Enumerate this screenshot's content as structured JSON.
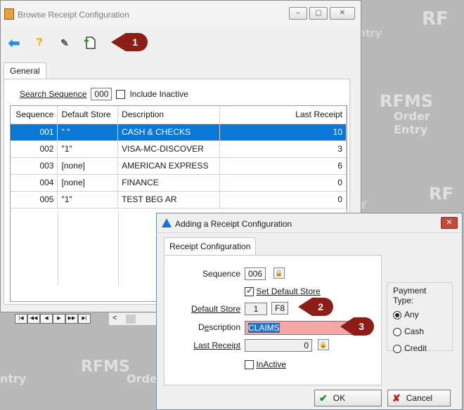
{
  "watermarks": [
    {
      "text": "RFMS",
      "sub": "Order Entry"
    }
  ],
  "browse": {
    "title": "Browse Receipt Configuration",
    "window_buttons": [
      "–",
      "▢",
      "✕"
    ],
    "toolbar_icons": [
      "back-arrow-icon",
      "help-question-icon",
      "tools-icon",
      "add-document-icon",
      "delete-document-icon"
    ],
    "tab": "General",
    "search_label": "Search Sequence",
    "search_value": "000",
    "include_inactive": "Include Inactive",
    "columns": [
      "Sequence",
      "Default Store",
      "Description",
      "Last Receipt"
    ],
    "rows": [
      {
        "seq": "001",
        "store": "\" \"",
        "desc": "CASH & CHECKS",
        "last": "10"
      },
      {
        "seq": "002",
        "store": "\"1\"",
        "desc": "VISA-MC-DISCOVER",
        "last": "3"
      },
      {
        "seq": "003",
        "store": "[none]",
        "desc": "AMERICAN EXPRESS",
        "last": "6"
      },
      {
        "seq": "004",
        "store": "[none]",
        "desc": "FINANCE",
        "last": "0"
      },
      {
        "seq": "005",
        "store": "\"1\"",
        "desc": "TEST BEG AR",
        "last": "0"
      }
    ],
    "nav_buttons": [
      "|◀",
      "◀◀",
      "◀",
      "▶",
      "▶▶",
      "▶|"
    ],
    "scroll_left": "<"
  },
  "dialog": {
    "title": "Adding a Receipt Configuration",
    "close": "✕",
    "tab": "Receipt Configuration",
    "sequence_label": "Sequence",
    "sequence_value": "006",
    "set_default_store": "Set Default Store",
    "default_store_label": "Default Store",
    "default_store_value": "1",
    "f8": "F8",
    "description_label": "Description",
    "description_value": "CLAIMS",
    "last_receipt_label": "Last Receipt",
    "last_receipt_value": "0",
    "inactive_label": "InActive",
    "payment_type_label": "Payment Type:",
    "payment_options": [
      "Any",
      "Cash",
      "Credit"
    ],
    "ok": "OK",
    "cancel": "Cancel"
  },
  "callouts": [
    "1",
    "2",
    "3"
  ],
  "colors": {
    "selection": "#0a78d7",
    "callout": "#8c1e17",
    "description_field": "#f4a7a7"
  }
}
